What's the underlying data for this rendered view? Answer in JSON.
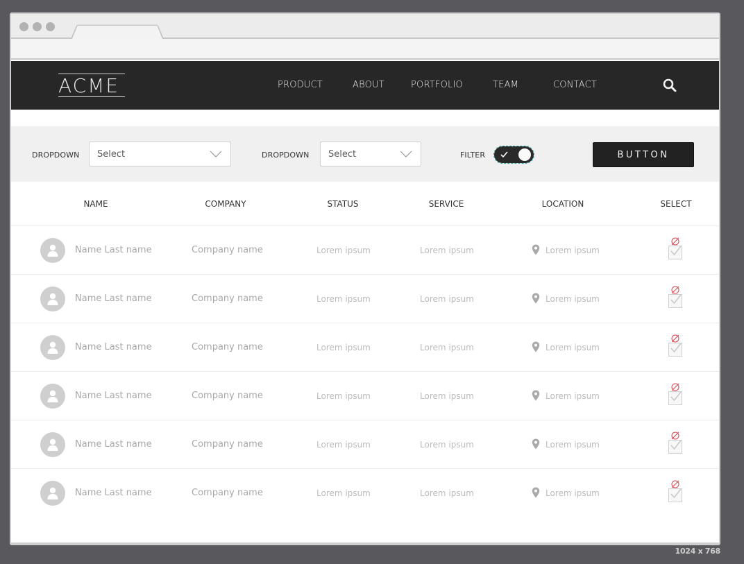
{
  "size_label": "1024 x 768",
  "brand": {
    "logo_text": "ACME"
  },
  "nav": {
    "items": [
      {
        "label": "PRODUCT"
      },
      {
        "label": "ABOUT"
      },
      {
        "label": "PORTFOLIO"
      },
      {
        "label": "TEAM"
      },
      {
        "label": "CONTACT"
      }
    ],
    "search_icon": "search-icon"
  },
  "filters": {
    "dropdown1": {
      "label": "DROPDOWN",
      "value": "Select"
    },
    "dropdown2": {
      "label": "DROPDOWN",
      "value": "Select"
    },
    "filter": {
      "label": "FILTER",
      "on": true
    },
    "button_label": "BUTTON"
  },
  "table": {
    "headers": [
      "NAME",
      "COMPANY",
      "STATUS",
      "SERVICE",
      "LOCATION",
      "SELECT"
    ],
    "rows": [
      {
        "name": "Name Last name",
        "company": "Company name",
        "status": "Lorem ipsum",
        "service": "Lorem ipsum",
        "location": "Lorem ipsum"
      },
      {
        "name": "Name Last name",
        "company": "Company name",
        "status": "Lorem ipsum",
        "service": "Lorem ipsum",
        "location": "Lorem ipsum"
      },
      {
        "name": "Name Last name",
        "company": "Company name",
        "status": "Lorem ipsum",
        "service": "Lorem ipsum",
        "location": "Lorem ipsum"
      },
      {
        "name": "Name Last name",
        "company": "Company name",
        "status": "Lorem ipsum",
        "service": "Lorem ipsum",
        "location": "Lorem ipsum"
      },
      {
        "name": "Name Last name",
        "company": "Company name",
        "status": "Lorem ipsum",
        "service": "Lorem ipsum",
        "location": "Lorem ipsum"
      },
      {
        "name": "Name Last name",
        "company": "Company name",
        "status": "Lorem ipsum",
        "service": "Lorem ipsum",
        "location": "Lorem ipsum"
      }
    ]
  },
  "colors": {
    "navbar": "#272727",
    "filterbar": "#f0f0f0",
    "button": "#222222",
    "select_icon_accent": "#d9434f"
  }
}
